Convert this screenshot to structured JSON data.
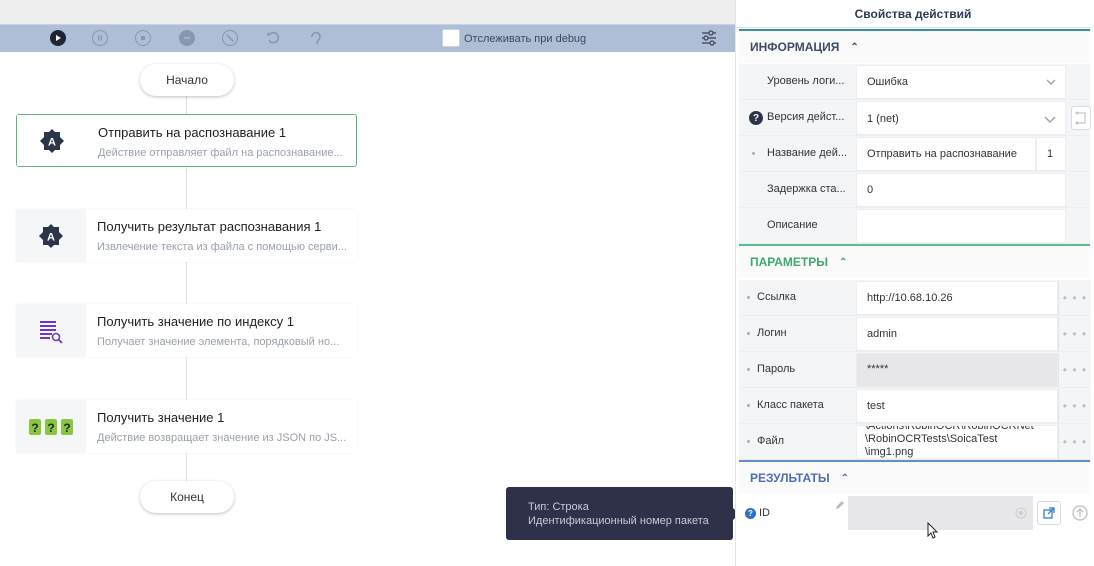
{
  "toolbar": {
    "debug_label": "Отслеживать при debug",
    "icons": [
      "play-icon",
      "pause-icon",
      "stop-icon",
      "minus-icon",
      "disable-icon",
      "undo-icon",
      "redo-icon",
      "filter-settings-icon"
    ]
  },
  "flow": {
    "start_label": "Начало",
    "end_label": "Конец",
    "nodes": [
      {
        "title": "Отправить на распознавание  1",
        "desc": "Действие отправляет файл на распознавание...",
        "icon": "ocr-send-icon"
      },
      {
        "title": "Получить результат распознавания  1",
        "desc": "Извлечение текста из файла с помощью серви...",
        "icon": "ocr-result-icon"
      },
      {
        "title": "Получить значение по индексу  1",
        "desc": "Получает значение элемента, порядковый но...",
        "icon": "list-search-icon"
      },
      {
        "title": "Получить значение  1",
        "desc": "Действие возвращает значение из JSON по JS...",
        "icon": "json-value-icon"
      }
    ]
  },
  "tooltip": {
    "type_line": "Тип: Строка",
    "desc_line": "Идентификационный номер пакета"
  },
  "panel": {
    "title": "Свойства действий",
    "info": {
      "heading": "ИНФОРМАЦИЯ",
      "rows": [
        {
          "label": "Уровень логи...",
          "value": "Ошибка"
        },
        {
          "label": "Версия дейст...",
          "value": "1 (net)"
        },
        {
          "label": "Название дей...",
          "value": "Отправить на распознавание",
          "suffix": "1"
        },
        {
          "label": "Задержка ста...",
          "value": "0"
        },
        {
          "label": "Описание",
          "value": ""
        }
      ]
    },
    "params": {
      "heading": "ПАРАМЕТРЫ",
      "rows": [
        {
          "label": "Ссылка",
          "value": "http://10.68.10.26"
        },
        {
          "label": "Логин",
          "value": "admin"
        },
        {
          "label": "Пароль",
          "value": "*****"
        },
        {
          "label": "Класс пакета",
          "value": "test"
        },
        {
          "label": "Файл",
          "value_lines": [
            "\\Actions\\RobinOCR\\RobinOCRNet",
            "\\RobinOCRTests\\SoicaTest",
            "\\img1.png"
          ]
        }
      ],
      "more_label": "• • •"
    },
    "results": {
      "heading": "РЕЗУЛЬТАТЫ",
      "rows": [
        {
          "label": "ID",
          "value": ""
        }
      ]
    },
    "colors": {
      "info_accent": "#3a8ea0",
      "params_accent": "#3ea86b",
      "results_accent": "#4a6fb5",
      "toolbar_bg": "#aebed6",
      "tooltip_bg": "#2f3049",
      "selected_border": "#5cb67e"
    }
  }
}
